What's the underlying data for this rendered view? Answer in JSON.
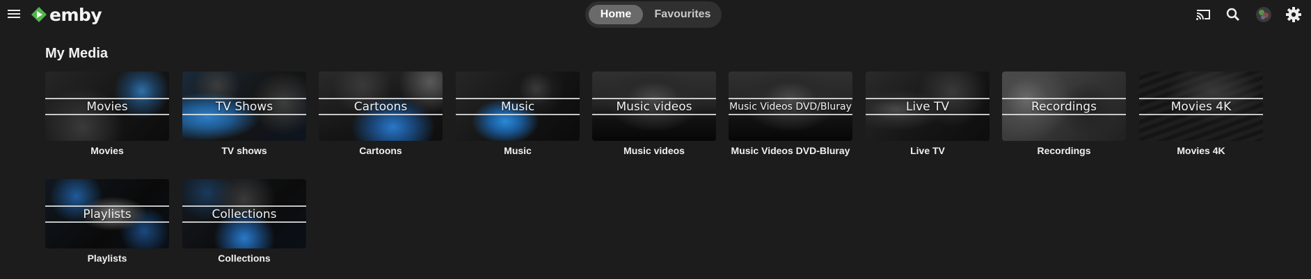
{
  "header": {
    "logo_text": "emby",
    "tabs": [
      {
        "label": "Home",
        "active": true
      },
      {
        "label": "Favourites",
        "active": false
      }
    ],
    "icons": [
      "menu-icon",
      "cast-icon",
      "search-icon",
      "avatar",
      "gear-icon"
    ]
  },
  "section": {
    "title": "My Media"
  },
  "libraries": [
    {
      "overlay": "Movies",
      "caption": "Movies"
    },
    {
      "overlay": "TV Shows",
      "caption": "TV shows"
    },
    {
      "overlay": "Cartoons",
      "caption": "Cartoons"
    },
    {
      "overlay": "Music",
      "caption": "Music"
    },
    {
      "overlay": "Music videos",
      "caption": "Music videos"
    },
    {
      "overlay": "Music Videos DVD/Bluray",
      "caption": "Music Videos DVD-Bluray"
    },
    {
      "overlay": "Live TV",
      "caption": "Live TV"
    },
    {
      "overlay": "Recordings",
      "caption": "Recordings"
    },
    {
      "overlay": "Movies 4K",
      "caption": "Movies 4K"
    },
    {
      "overlay": "Playlists",
      "caption": "Playlists"
    },
    {
      "overlay": "Collections",
      "caption": "Collections"
    }
  ],
  "colors": {
    "background": "#1c1c1c",
    "brand_green": "#52b54b",
    "accent_blue": "#2a8ad8"
  }
}
